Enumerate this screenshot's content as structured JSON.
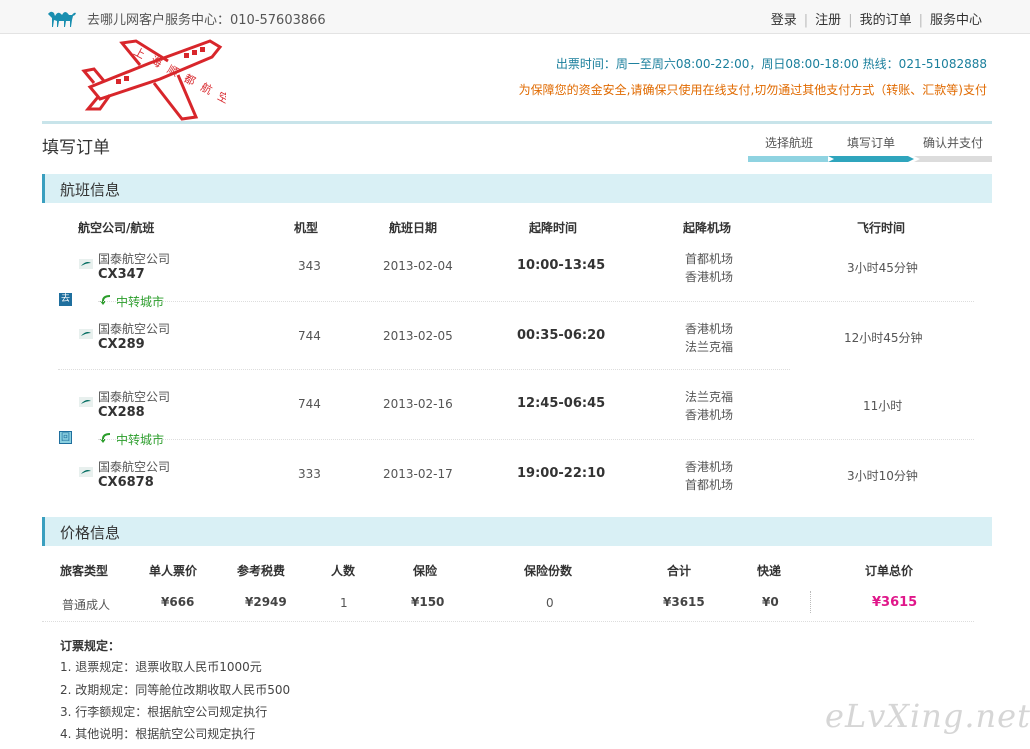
{
  "topbar": {
    "service_text": "去哪儿网客户服务中心：010-57603866",
    "nav": [
      "登录",
      "注册",
      "我的订单",
      "服务中心"
    ]
  },
  "header": {
    "brand_text": "上海顺都航空",
    "hours": "出票时间：周一至周六08:00-22:00，周日08:00-18:00  热线：021-51082888",
    "warning": "为保障您的资金安全,请确保只使用在线支付,切勿通过其他支付方式（转账、汇款等)支付"
  },
  "page_title": "填写订单",
  "steps": [
    "选择航班",
    "填写订单",
    "确认并支付"
  ],
  "flight_section": {
    "title": "航班信息",
    "headers": [
      "航空公司/航班",
      "机型",
      "航班日期",
      "起降时间",
      "起降机场",
      "飞行时间"
    ],
    "outbound_badge": "去",
    "return_badge": "回",
    "transfer_label": "中转城市",
    "flights": [
      {
        "airline": "国泰航空公司",
        "flight": "CX347",
        "model": "343",
        "date": "2013-02-04",
        "time": "10:00-13:45",
        "dep": "首都机场",
        "arr": "香港机场",
        "duration": "3小时45分钟"
      },
      {
        "airline": "国泰航空公司",
        "flight": "CX289",
        "model": "744",
        "date": "2013-02-05",
        "time": "00:35-06:20",
        "dep": "香港机场",
        "arr": "法兰克福",
        "duration": "12小时45分钟"
      },
      {
        "airline": "国泰航空公司",
        "flight": "CX288",
        "model": "744",
        "date": "2013-02-16",
        "time": "12:45-06:45",
        "dep": "法兰克福",
        "arr": "香港机场",
        "duration": "11小时"
      },
      {
        "airline": "国泰航空公司",
        "flight": "CX6878",
        "model": "333",
        "date": "2013-02-17",
        "time": "19:00-22:10",
        "dep": "香港机场",
        "arr": "首都机场",
        "duration": "3小时10分钟"
      }
    ]
  },
  "price_section": {
    "title": "价格信息",
    "headers": [
      "旅客类型",
      "单人票价",
      "参考税费",
      "人数",
      "保险",
      "保险份数",
      "合计",
      "快递",
      "订单总价"
    ],
    "row": {
      "type": "普通成人",
      "price": "¥666",
      "tax": "¥2949",
      "count": "1",
      "insurance": "¥150",
      "ins_count": "0",
      "subtotal": "¥3615",
      "express": "¥0",
      "total": "¥3615"
    }
  },
  "rules": {
    "title": "订票规定：",
    "items": [
      "1. 退票规定：退票收取人民币1000元",
      "2. 改期规定：同等舱位改期收取人民币500",
      "3. 行李额规定：根据航空公司规定执行",
      "4. 其他说明：根据航空公司规定执行"
    ]
  },
  "watermark": "eLvXing.net",
  "colors": {
    "accent": "#3a9fbf",
    "transfer": "#2a9d2a",
    "total": "#e0178a",
    "warning": "#e06a00",
    "brand_red": "#d8262b"
  }
}
